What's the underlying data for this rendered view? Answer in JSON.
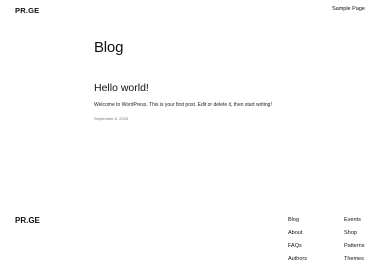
{
  "header": {
    "site_title": "PR.GE",
    "nav": [
      "Sample Page"
    ]
  },
  "main": {
    "heading": "Blog",
    "posts": [
      {
        "title": "Hello world!",
        "excerpt": "Welcome to WordPress. This is your first post. Edit or delete it, then start writing!",
        "date": "September 8, 2025"
      }
    ]
  },
  "footer": {
    "site_title": "PR.GE",
    "col1": [
      "Blog",
      "About",
      "FAQs",
      "Authors"
    ],
    "col2": [
      "Events",
      "Shop",
      "Patterns",
      "Themes"
    ]
  }
}
